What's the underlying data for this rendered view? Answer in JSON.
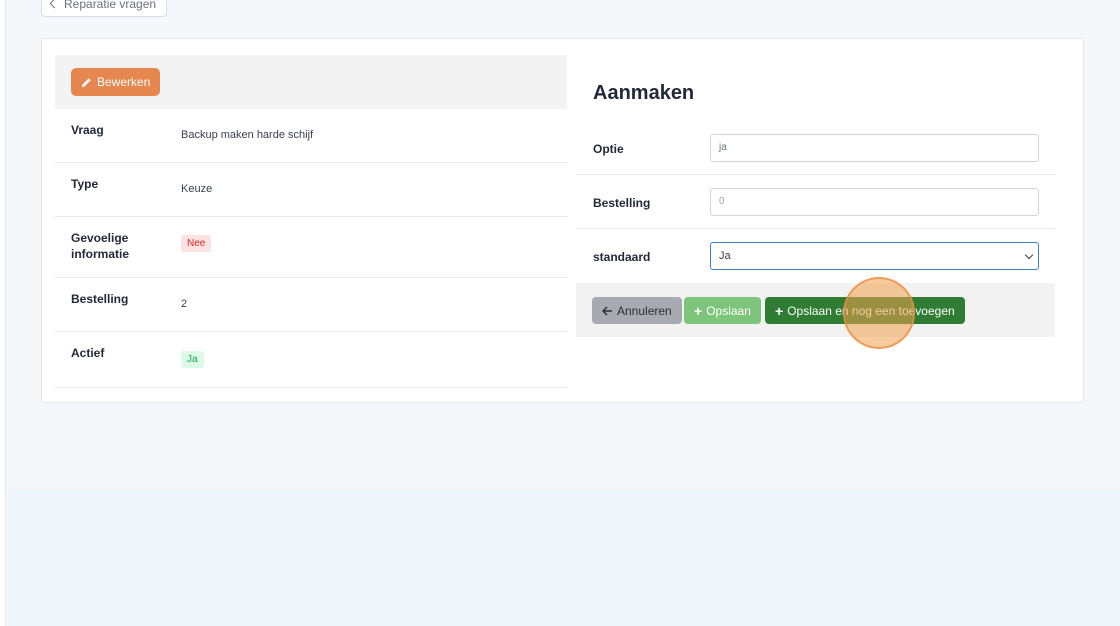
{
  "back_link": {
    "label": "Reparatie vragen"
  },
  "detail": {
    "edit_label": "Bewerken",
    "rows": [
      {
        "label": "Vraag",
        "value": "Backup maken harde schijf"
      },
      {
        "label": "Type",
        "value": "Keuze"
      },
      {
        "label": "Gevoelige informatie",
        "value": "Nee"
      },
      {
        "label": "Bestelling",
        "value": "2"
      },
      {
        "label": "Actief",
        "value": "Ja"
      }
    ]
  },
  "form": {
    "title": "Aanmaken",
    "fields": [
      {
        "label": "Optie",
        "value": "ja"
      },
      {
        "label": "Bestelling",
        "placeholder": "0"
      },
      {
        "label": "standaard",
        "selected": "Ja"
      }
    ],
    "buttons": {
      "cancel": "Annuleren",
      "save": "Opslaan",
      "save_more": "Opslaan en nog een toevoegen"
    }
  },
  "colors": {
    "edit": "#e5874e",
    "save": "#7cc57a",
    "save_more": "#2e7d32",
    "badge_no": "#dc2626",
    "badge_yes": "#16a34a"
  }
}
